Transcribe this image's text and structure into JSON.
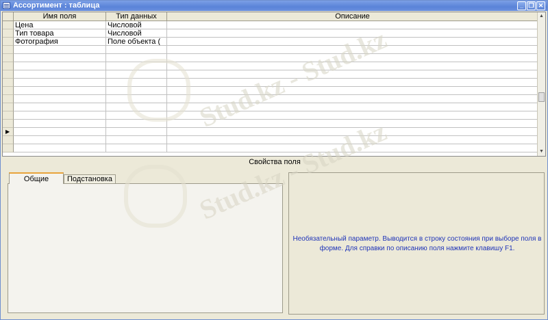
{
  "window": {
    "title": "Ассортимент : таблица"
  },
  "grid": {
    "headers": [
      "Имя поля",
      "Тип данных",
      "Описание"
    ],
    "rows": [
      {
        "name": "Цена",
        "type": "Числовой",
        "desc": ""
      },
      {
        "name": "Тип товара",
        "type": "Числовой",
        "desc": ""
      },
      {
        "name": "Фотография",
        "type": "Поле объекта (",
        "desc": ""
      }
    ]
  },
  "properties": {
    "label": "Свойства поля",
    "tabs": [
      {
        "label": "Общие",
        "active": true
      },
      {
        "label": "Подстановка",
        "active": false
      }
    ],
    "description": "Необязательный параметр.  Выводится в строку состояния при выборе поля в форме.  Для справки по описанию поля нажмите клавишу F1."
  },
  "watermark": {
    "text": "Stud.kz - Stud.kz"
  }
}
